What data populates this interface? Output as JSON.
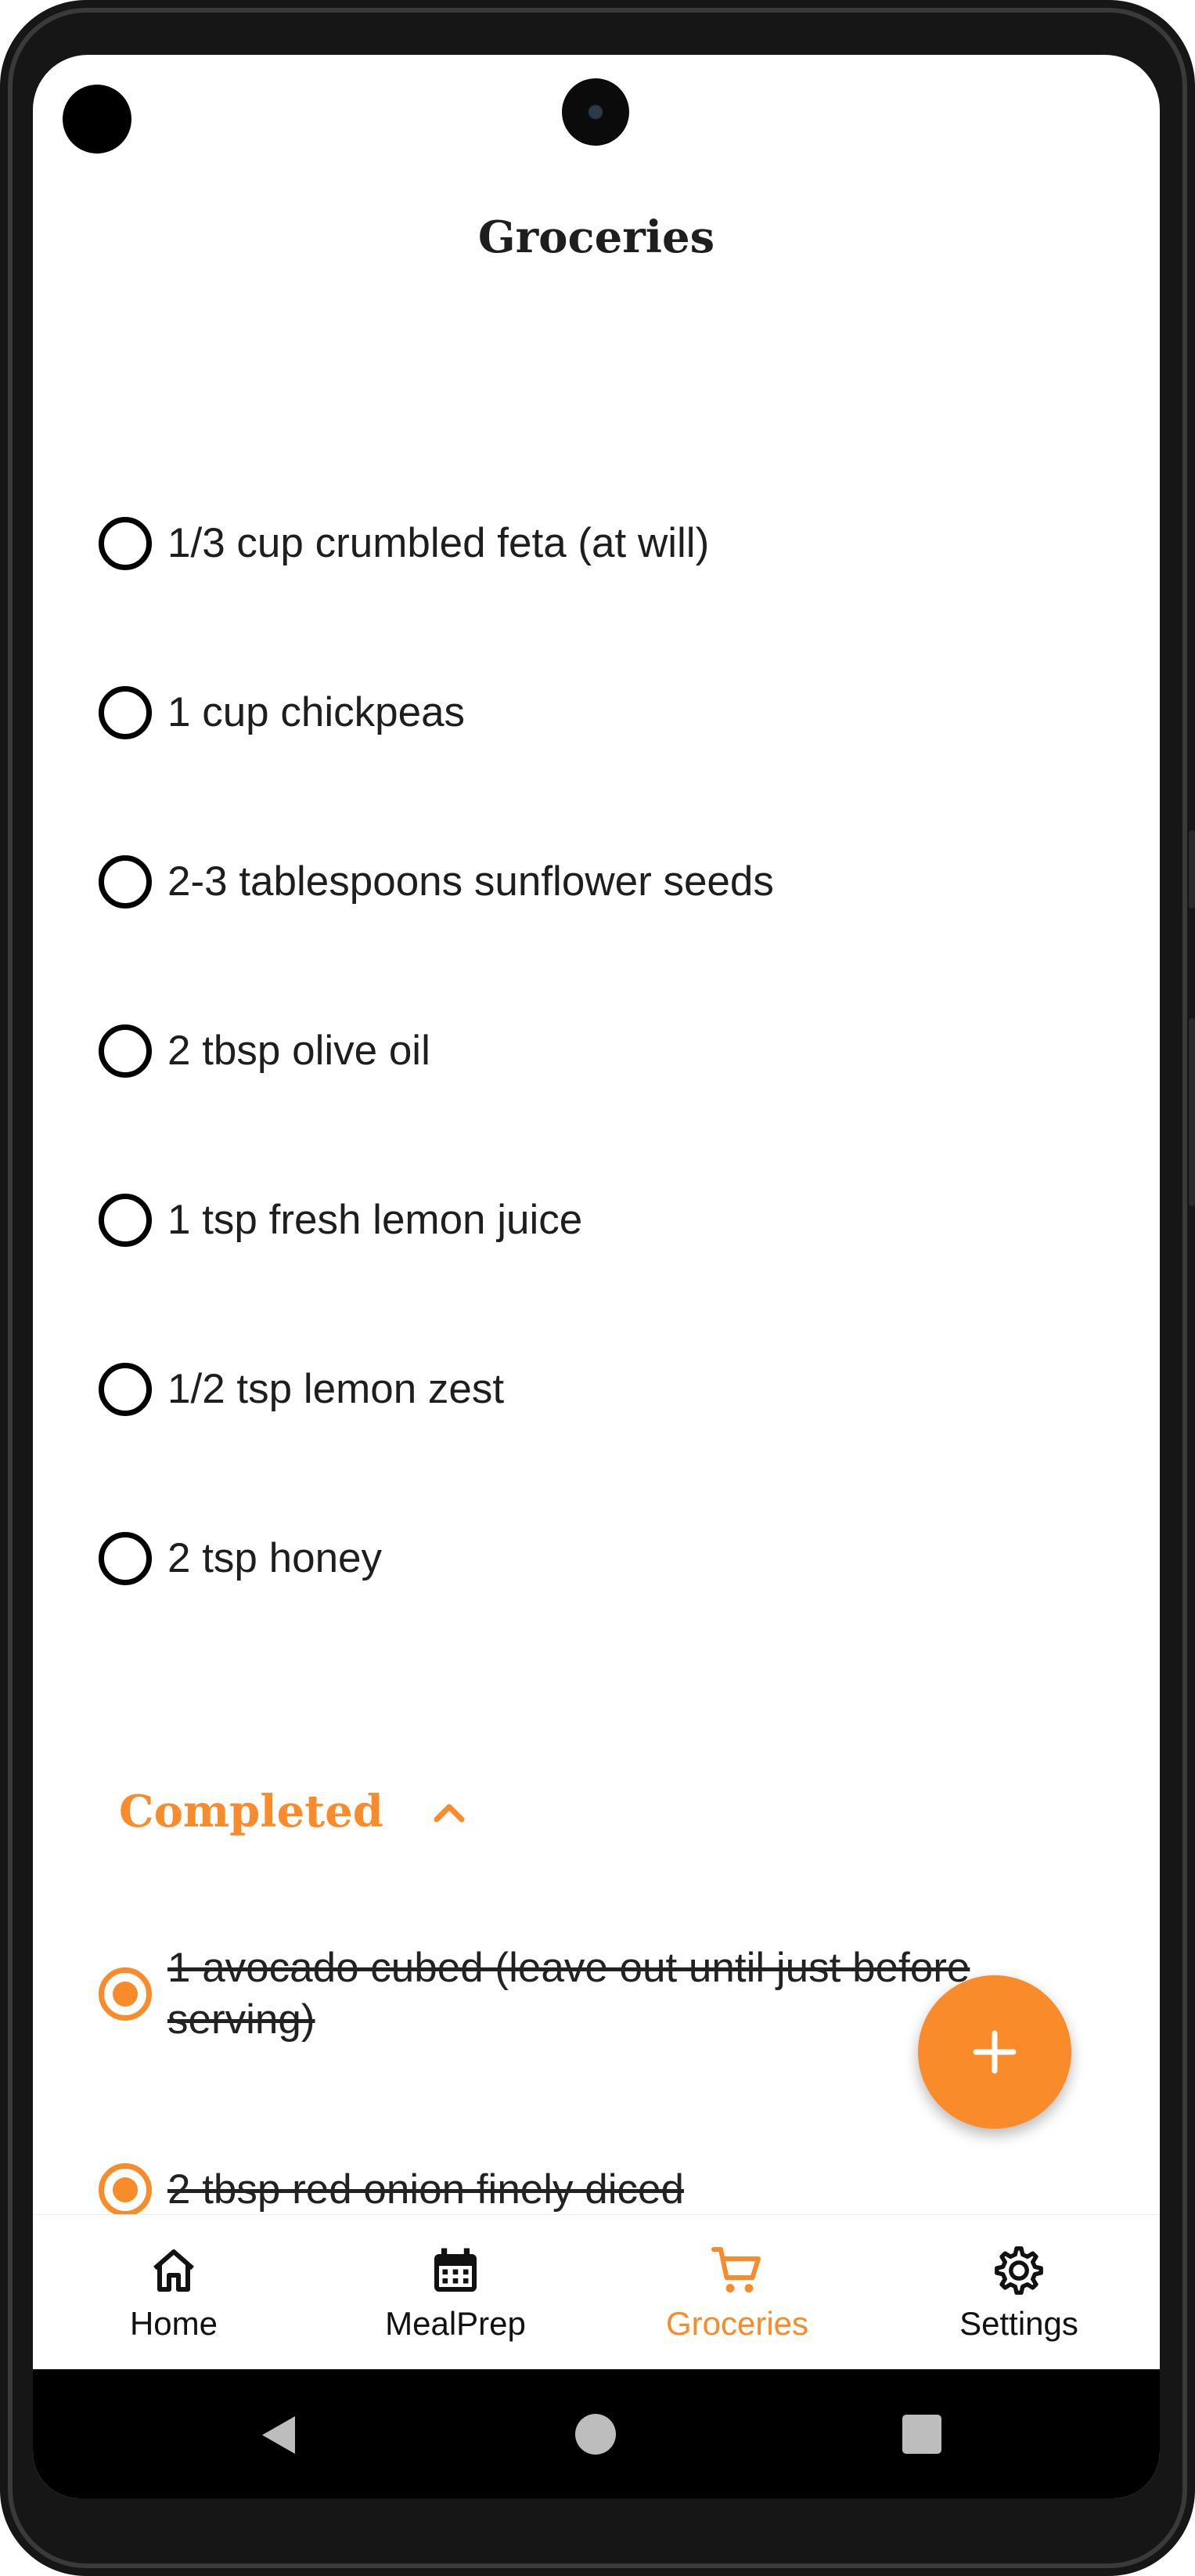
{
  "app": {
    "title": "Groceries",
    "accent_color": "#F98B2A"
  },
  "grocery_items": [
    {
      "label": "1/3 cup crumbled feta (at will)",
      "checked": false
    },
    {
      "label": "1 cup chickpeas",
      "checked": false
    },
    {
      "label": "2-3 tablespoons sunflower seeds",
      "checked": false
    },
    {
      "label": "2 tbsp olive oil",
      "checked": false
    },
    {
      "label": "1 tsp fresh lemon juice",
      "checked": false
    },
    {
      "label": "1/2 tsp lemon zest",
      "checked": false
    },
    {
      "label": "2 tsp honey",
      "checked": false
    }
  ],
  "completed": {
    "label": "Completed",
    "expanded": true,
    "icon": "chevron-up-icon",
    "items": [
      {
        "label": "1 avocado cubed (leave out until just before serving)",
        "checked": true
      },
      {
        "label": "2 tbsp red onion finely diced",
        "checked": true
      }
    ]
  },
  "fab": {
    "icon": "plus-icon"
  },
  "bottom_nav": {
    "items": [
      {
        "label": "Home",
        "icon": "home-icon",
        "active": false
      },
      {
        "label": "MealPrep",
        "icon": "calendar-icon",
        "active": false
      },
      {
        "label": "Groceries",
        "icon": "cart-icon",
        "active": true
      },
      {
        "label": "Settings",
        "icon": "gear-icon",
        "active": false
      }
    ]
  },
  "system_nav": {
    "back_icon": "back-triangle-icon",
    "home_icon": "home-circle-icon",
    "recents_icon": "recents-square-icon"
  }
}
